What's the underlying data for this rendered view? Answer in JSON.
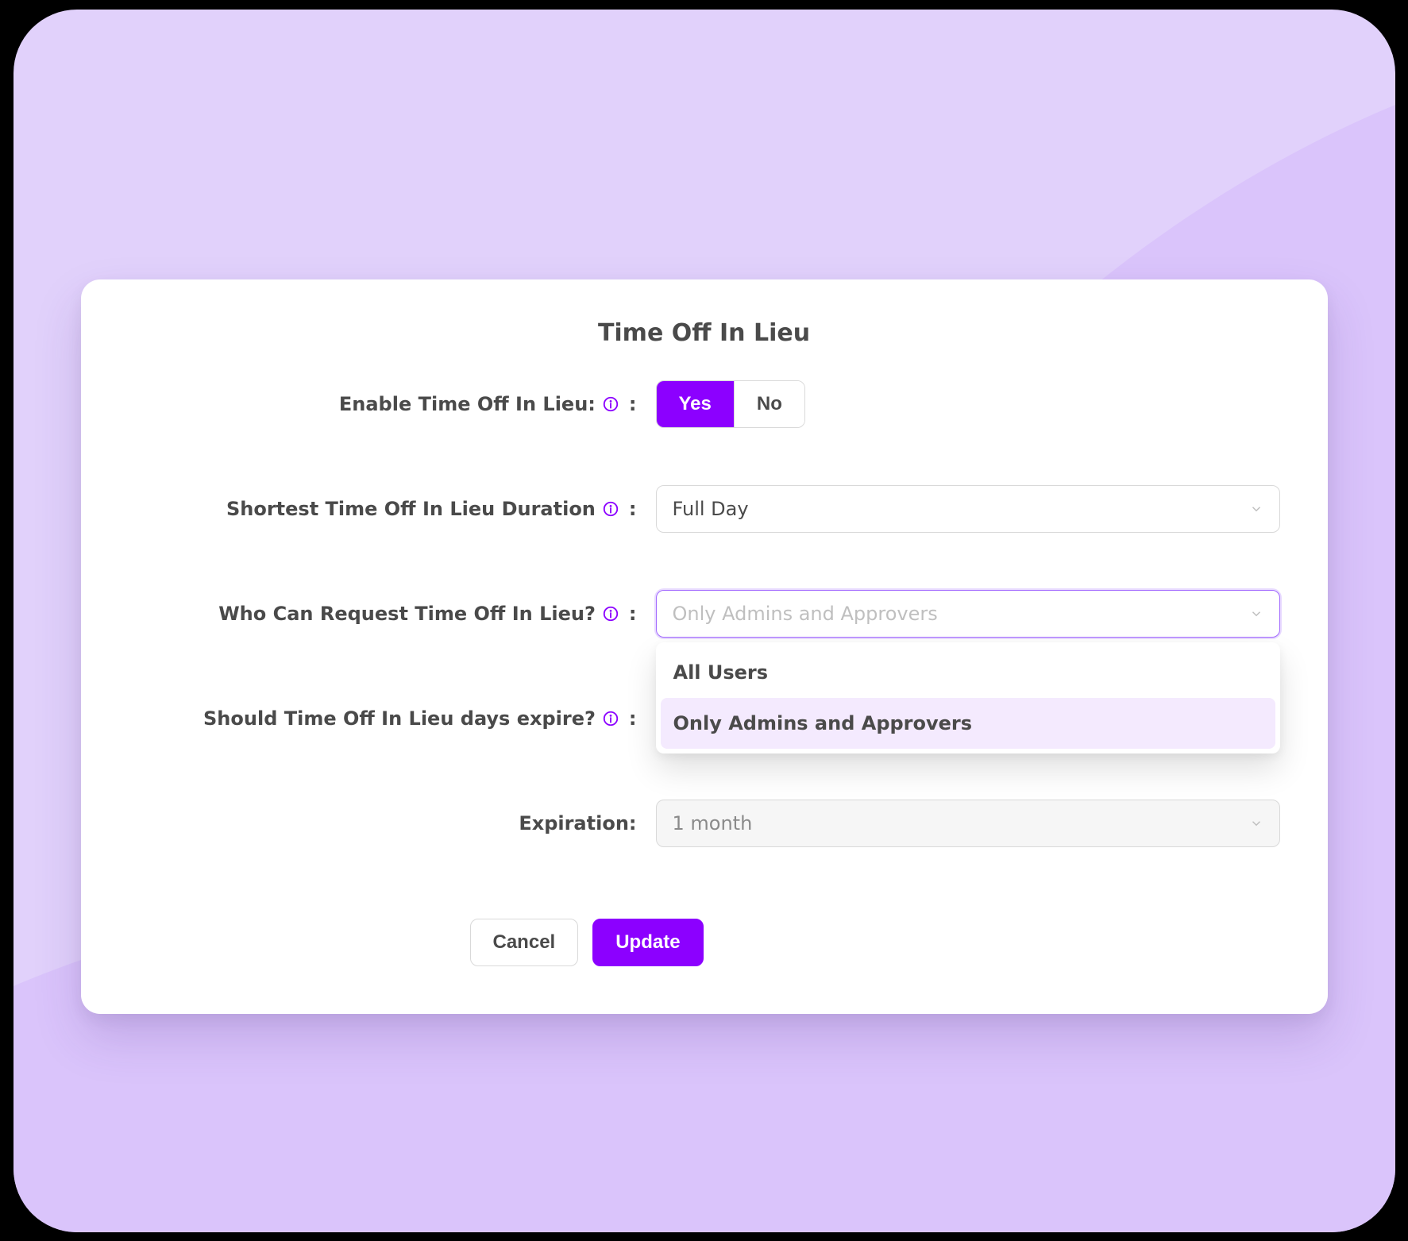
{
  "card": {
    "title": "Time Off In Lieu"
  },
  "fields": {
    "enable": {
      "label": "Enable Time Off In Lieu:",
      "yes": "Yes",
      "no": "No"
    },
    "shortest": {
      "label": "Shortest Time Off In Lieu Duration",
      "value": "Full Day"
    },
    "who": {
      "label": "Who Can Request Time Off In Lieu?",
      "placeholder": "Only Admins and Approvers",
      "options": {
        "all": "All Users",
        "admins": "Only Admins and Approvers"
      }
    },
    "expire": {
      "label": "Should Time Off In Lieu days expire?"
    },
    "expiration": {
      "label": "Expiration:",
      "value": "1 month"
    }
  },
  "actions": {
    "cancel": "Cancel",
    "update": "Update"
  },
  "colors": {
    "accent": "#8C00FF"
  }
}
